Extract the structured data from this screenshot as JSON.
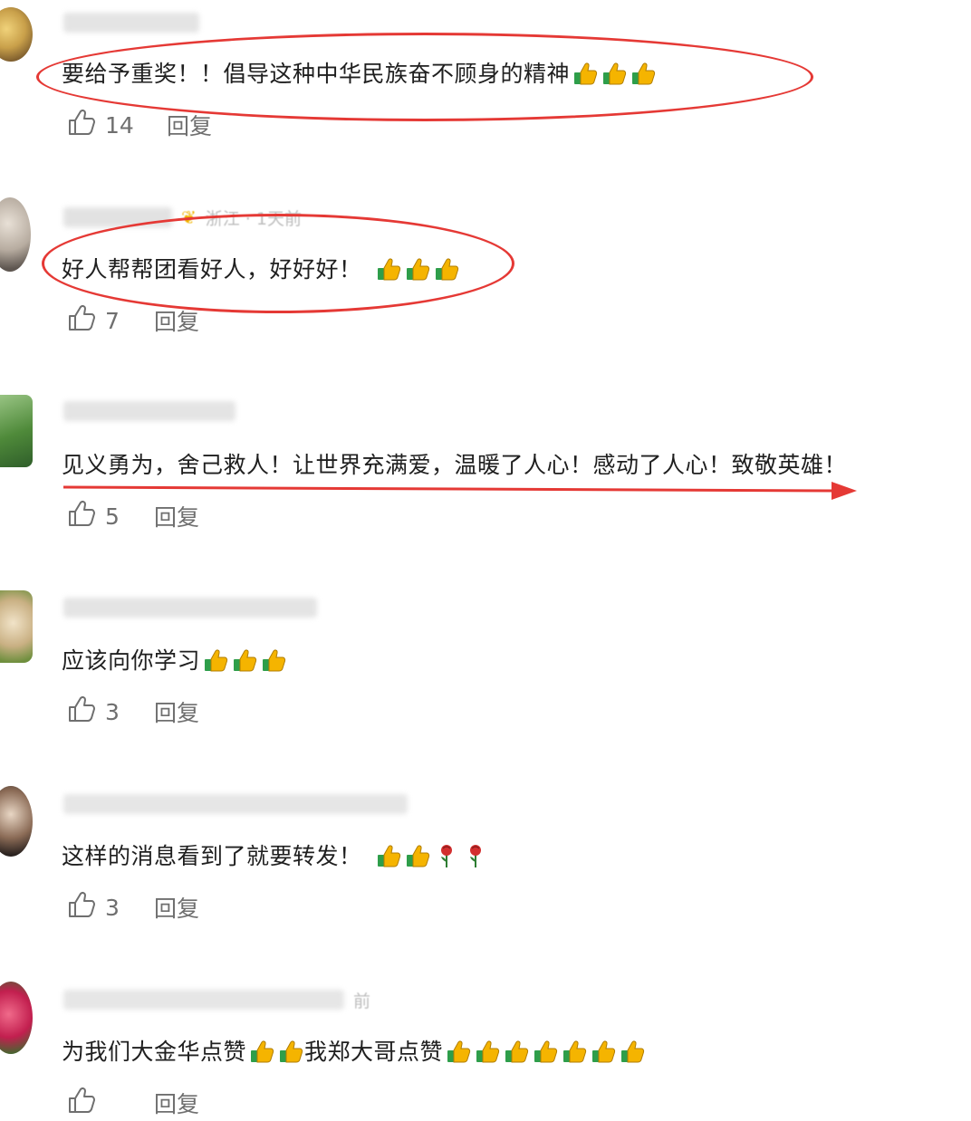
{
  "comments": [
    {
      "meta": "",
      "text": "要给予重奖！！倡导这种中华民族奋不顾身的精神",
      "emojis": [
        "thumbs-up",
        "thumbs-up",
        "thumbs-up"
      ],
      "likes": "14",
      "reply": "回复"
    },
    {
      "meta": "浙江 · 1天前",
      "text": "好人帮帮团看好人，好好好！",
      "emojis": [
        "thumbs-up",
        "thumbs-up",
        "thumbs-up"
      ],
      "likes": "7",
      "reply": "回复"
    },
    {
      "meta": "",
      "text": "见义勇为，舍己救人！让世界充满爱，温暖了人心！感动了人心！致敬英雄！",
      "emojis": [],
      "likes": "5",
      "reply": "回复"
    },
    {
      "meta": "",
      "text": "应该向你学习",
      "emojis": [
        "thumbs-up",
        "thumbs-up",
        "thumbs-up"
      ],
      "likes": "3",
      "reply": "回复"
    },
    {
      "meta": "",
      "text": "这样的消息看到了就要转发！",
      "emojis": [
        "thumbs-up",
        "thumbs-up",
        "rose",
        "rose"
      ],
      "likes": "3",
      "reply": "回复"
    },
    {
      "meta": "前",
      "text": "为我们大金华点赞",
      "text2": "我郑大哥点赞",
      "emojis_mid": [
        "thumbs-up",
        "thumbs-up"
      ],
      "emojis": [
        "thumbs-up",
        "thumbs-up",
        "thumbs-up",
        "thumbs-up",
        "thumbs-up",
        "thumbs-up",
        "thumbs-up"
      ],
      "likes": "",
      "reply": "回复"
    }
  ],
  "colors": {
    "annotation": "#e53935",
    "emoji_thumb": "#f5b400",
    "emoji_cuff": "#2e9e4a",
    "rose": "#d32f2f"
  }
}
